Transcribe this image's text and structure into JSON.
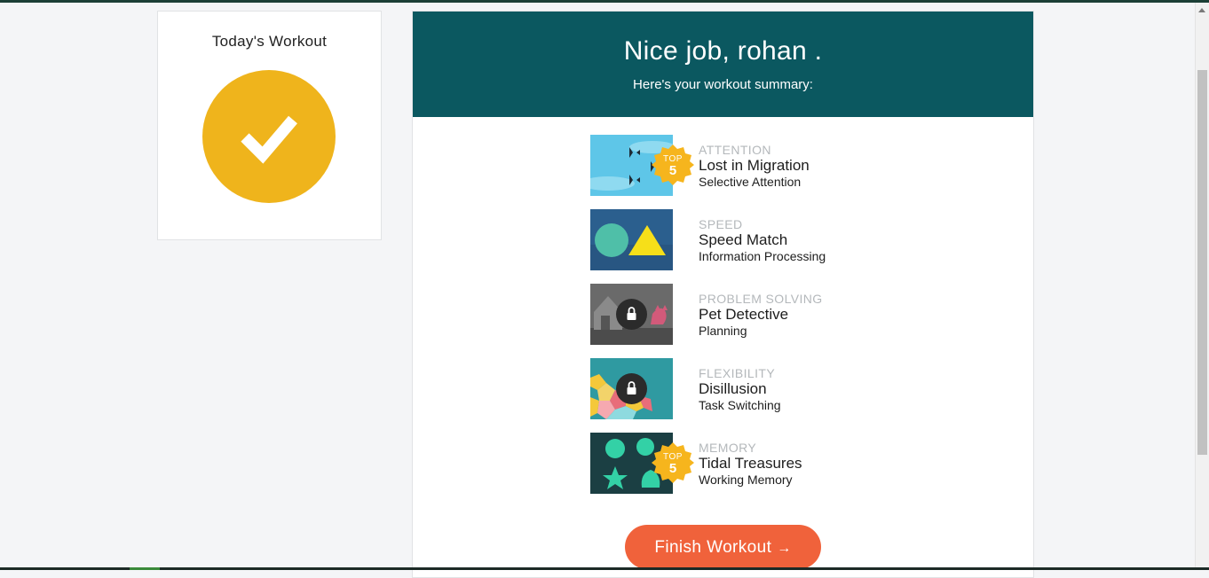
{
  "today": {
    "title": "Today's Workout",
    "status_icon": "check-icon",
    "accent_color": "#efb41c"
  },
  "summary": {
    "title": "Nice job, rohan .",
    "subtitle": "Here's your workout summary:",
    "header_color": "#0b5860"
  },
  "games": [
    {
      "category": "ATTENTION",
      "name": "Lost in Migration",
      "skill": "Selective Attention",
      "badge": {
        "label": "TOP",
        "number": "5"
      },
      "locked": false,
      "thumbnail_icon": "birds-thumbnail"
    },
    {
      "category": "SPEED",
      "name": "Speed Match",
      "skill": "Information Processing",
      "badge": null,
      "locked": false,
      "thumbnail_icon": "shapes-thumbnail"
    },
    {
      "category": "PROBLEM SOLVING",
      "name": "Pet Detective",
      "skill": "Planning",
      "badge": null,
      "locked": true,
      "thumbnail_icon": "pets-thumbnail"
    },
    {
      "category": "FLEXIBILITY",
      "name": "Disillusion",
      "skill": "Task Switching",
      "badge": null,
      "locked": true,
      "thumbnail_icon": "tiles-thumbnail"
    },
    {
      "category": "MEMORY",
      "name": "Tidal Treasures",
      "skill": "Working Memory",
      "badge": {
        "label": "TOP",
        "number": "5"
      },
      "locked": false,
      "thumbnail_icon": "shells-thumbnail"
    }
  ],
  "finish_button": {
    "label": "Finish Workout",
    "arrow": "→",
    "color": "#f0623b"
  }
}
